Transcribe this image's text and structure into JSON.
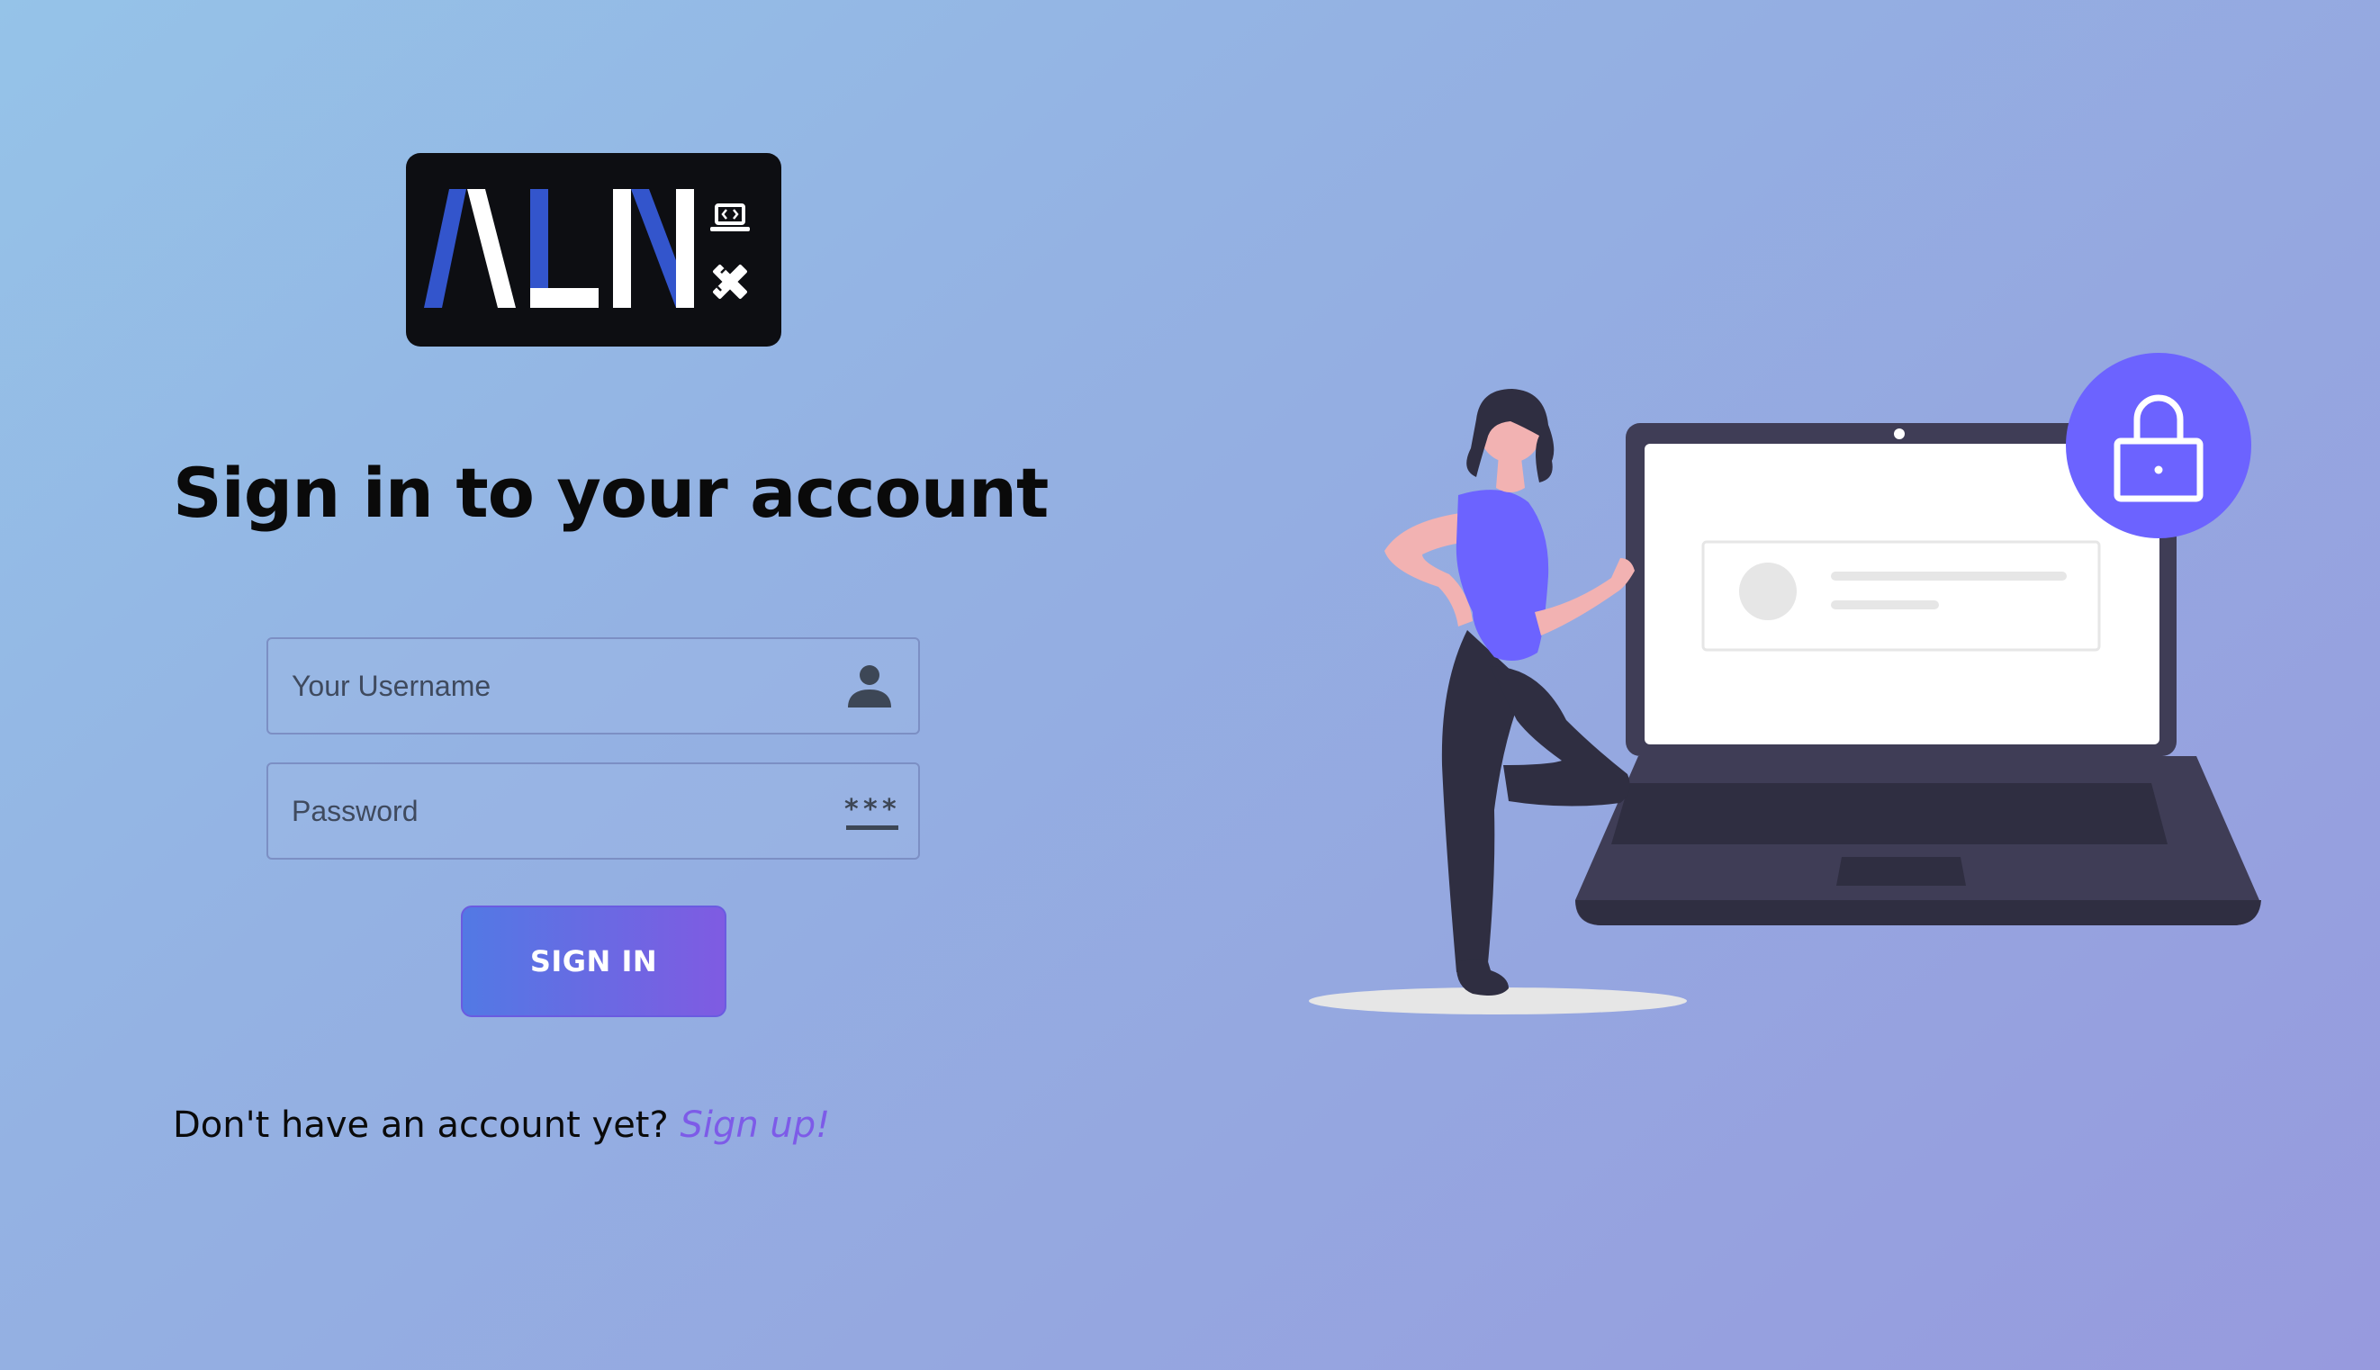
{
  "logo": {
    "text": "ALN",
    "icons": [
      "laptop-code-icon",
      "pencil-ruler-icon"
    ],
    "background": "#0d0e12",
    "accent": "#3355cc"
  },
  "heading": "Sign in to your account",
  "form": {
    "username_placeholder": "Your Username",
    "username_icon": "user-icon",
    "password_placeholder": "Password",
    "password_icon": "password-icon",
    "submit_label": "SIGN IN"
  },
  "footer": {
    "prompt": "Don't have an account yet?",
    "link_label": "Sign up!"
  },
  "illustration": {
    "subject": "woman-with-laptop-illustration",
    "lock_icon": "lock-icon"
  },
  "colors": {
    "button_start": "#5279e4",
    "button_end": "#7f5be2",
    "link": "#7d5be8",
    "illustration_accent": "#6c63ff"
  }
}
